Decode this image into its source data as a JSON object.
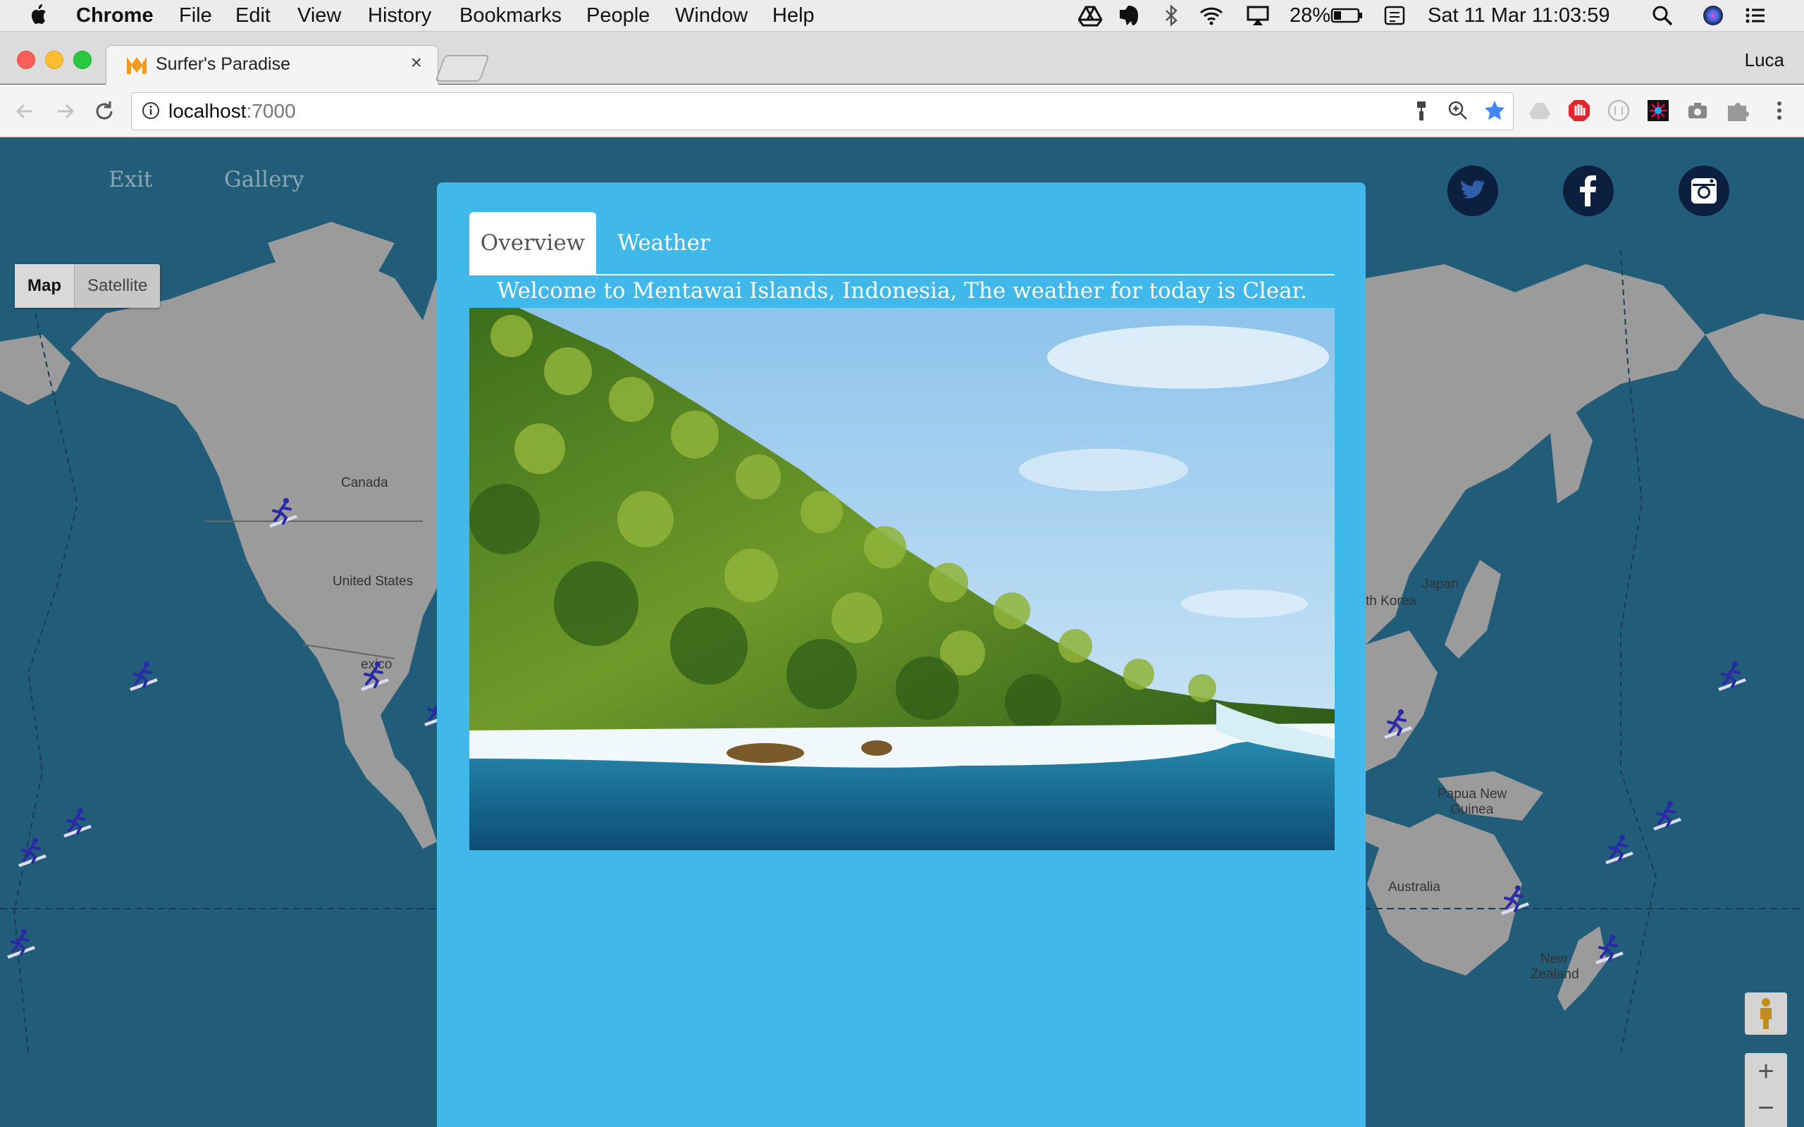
{
  "menubar": {
    "app_name": "Chrome",
    "items": [
      "File",
      "Edit",
      "View",
      "History",
      "Bookmarks",
      "People",
      "Window",
      "Help"
    ],
    "battery_percent": "28%",
    "clock": "Sat 11 Mar  11:03:59"
  },
  "browser": {
    "tab_title": "Surfer's Paradise",
    "profile_name": "Luca",
    "url_host": "localhost",
    "url_port": ":7000"
  },
  "page": {
    "nav": {
      "exit_label": "Exit",
      "gallery_label": "Gallery"
    },
    "map_type": {
      "map_label": "Map",
      "satellite_label": "Satellite"
    },
    "map_labels": {
      "canada": "Canada",
      "united_states": "United States",
      "mexico": "exico",
      "south_korea": "th Korea",
      "japan": "Japan",
      "papua_line1": "Papua New",
      "papua_line2": "Guinea",
      "australia": "Australia",
      "nz_line1": "New",
      "nz_line2": "Zealand"
    },
    "zoom_in_label": "+",
    "zoom_out_label": "−"
  },
  "modal": {
    "tabs": [
      {
        "label": "Overview",
        "active": true
      },
      {
        "label": "Weather",
        "active": false
      }
    ],
    "welcome_text": "Welcome to Mentawai Islands, Indonesia, The weather for today is Clear."
  },
  "colors": {
    "modal_bg": "#40b9ea",
    "map_sea": "#215c79",
    "land": "#9b9b9b",
    "social_bg": "#0d1f3f"
  }
}
